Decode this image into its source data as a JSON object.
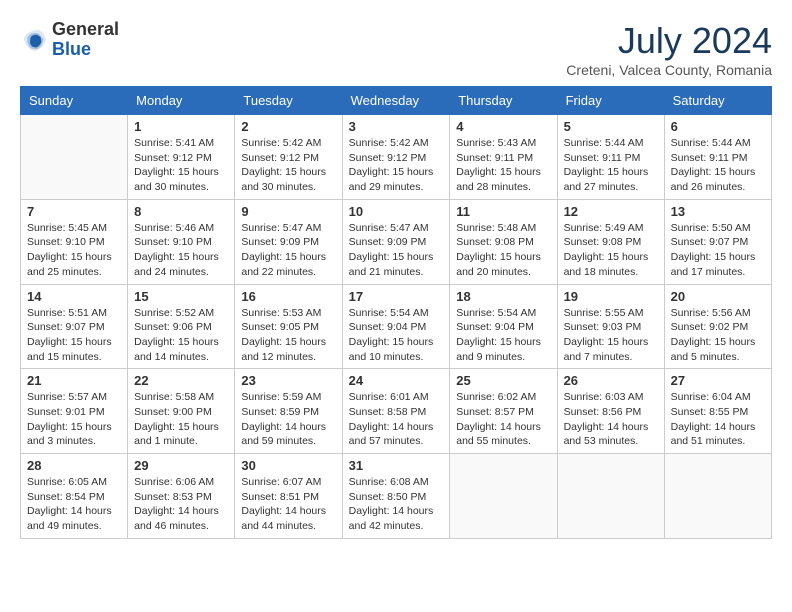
{
  "logo": {
    "general": "General",
    "blue": "Blue"
  },
  "title": "July 2024",
  "subtitle": "Creteni, Valcea County, Romania",
  "days_of_week": [
    "Sunday",
    "Monday",
    "Tuesday",
    "Wednesday",
    "Thursday",
    "Friday",
    "Saturday"
  ],
  "weeks": [
    [
      {
        "num": "",
        "info": ""
      },
      {
        "num": "1",
        "info": "Sunrise: 5:41 AM\nSunset: 9:12 PM\nDaylight: 15 hours\nand 30 minutes."
      },
      {
        "num": "2",
        "info": "Sunrise: 5:42 AM\nSunset: 9:12 PM\nDaylight: 15 hours\nand 30 minutes."
      },
      {
        "num": "3",
        "info": "Sunrise: 5:42 AM\nSunset: 9:12 PM\nDaylight: 15 hours\nand 29 minutes."
      },
      {
        "num": "4",
        "info": "Sunrise: 5:43 AM\nSunset: 9:11 PM\nDaylight: 15 hours\nand 28 minutes."
      },
      {
        "num": "5",
        "info": "Sunrise: 5:44 AM\nSunset: 9:11 PM\nDaylight: 15 hours\nand 27 minutes."
      },
      {
        "num": "6",
        "info": "Sunrise: 5:44 AM\nSunset: 9:11 PM\nDaylight: 15 hours\nand 26 minutes."
      }
    ],
    [
      {
        "num": "7",
        "info": "Sunrise: 5:45 AM\nSunset: 9:10 PM\nDaylight: 15 hours\nand 25 minutes."
      },
      {
        "num": "8",
        "info": "Sunrise: 5:46 AM\nSunset: 9:10 PM\nDaylight: 15 hours\nand 24 minutes."
      },
      {
        "num": "9",
        "info": "Sunrise: 5:47 AM\nSunset: 9:09 PM\nDaylight: 15 hours\nand 22 minutes."
      },
      {
        "num": "10",
        "info": "Sunrise: 5:47 AM\nSunset: 9:09 PM\nDaylight: 15 hours\nand 21 minutes."
      },
      {
        "num": "11",
        "info": "Sunrise: 5:48 AM\nSunset: 9:08 PM\nDaylight: 15 hours\nand 20 minutes."
      },
      {
        "num": "12",
        "info": "Sunrise: 5:49 AM\nSunset: 9:08 PM\nDaylight: 15 hours\nand 18 minutes."
      },
      {
        "num": "13",
        "info": "Sunrise: 5:50 AM\nSunset: 9:07 PM\nDaylight: 15 hours\nand 17 minutes."
      }
    ],
    [
      {
        "num": "14",
        "info": "Sunrise: 5:51 AM\nSunset: 9:07 PM\nDaylight: 15 hours\nand 15 minutes."
      },
      {
        "num": "15",
        "info": "Sunrise: 5:52 AM\nSunset: 9:06 PM\nDaylight: 15 hours\nand 14 minutes."
      },
      {
        "num": "16",
        "info": "Sunrise: 5:53 AM\nSunset: 9:05 PM\nDaylight: 15 hours\nand 12 minutes."
      },
      {
        "num": "17",
        "info": "Sunrise: 5:54 AM\nSunset: 9:04 PM\nDaylight: 15 hours\nand 10 minutes."
      },
      {
        "num": "18",
        "info": "Sunrise: 5:54 AM\nSunset: 9:04 PM\nDaylight: 15 hours\nand 9 minutes."
      },
      {
        "num": "19",
        "info": "Sunrise: 5:55 AM\nSunset: 9:03 PM\nDaylight: 15 hours\nand 7 minutes."
      },
      {
        "num": "20",
        "info": "Sunrise: 5:56 AM\nSunset: 9:02 PM\nDaylight: 15 hours\nand 5 minutes."
      }
    ],
    [
      {
        "num": "21",
        "info": "Sunrise: 5:57 AM\nSunset: 9:01 PM\nDaylight: 15 hours\nand 3 minutes."
      },
      {
        "num": "22",
        "info": "Sunrise: 5:58 AM\nSunset: 9:00 PM\nDaylight: 15 hours\nand 1 minute."
      },
      {
        "num": "23",
        "info": "Sunrise: 5:59 AM\nSunset: 8:59 PM\nDaylight: 14 hours\nand 59 minutes."
      },
      {
        "num": "24",
        "info": "Sunrise: 6:01 AM\nSunset: 8:58 PM\nDaylight: 14 hours\nand 57 minutes."
      },
      {
        "num": "25",
        "info": "Sunrise: 6:02 AM\nSunset: 8:57 PM\nDaylight: 14 hours\nand 55 minutes."
      },
      {
        "num": "26",
        "info": "Sunrise: 6:03 AM\nSunset: 8:56 PM\nDaylight: 14 hours\nand 53 minutes."
      },
      {
        "num": "27",
        "info": "Sunrise: 6:04 AM\nSunset: 8:55 PM\nDaylight: 14 hours\nand 51 minutes."
      }
    ],
    [
      {
        "num": "28",
        "info": "Sunrise: 6:05 AM\nSunset: 8:54 PM\nDaylight: 14 hours\nand 49 minutes."
      },
      {
        "num": "29",
        "info": "Sunrise: 6:06 AM\nSunset: 8:53 PM\nDaylight: 14 hours\nand 46 minutes."
      },
      {
        "num": "30",
        "info": "Sunrise: 6:07 AM\nSunset: 8:51 PM\nDaylight: 14 hours\nand 44 minutes."
      },
      {
        "num": "31",
        "info": "Sunrise: 6:08 AM\nSunset: 8:50 PM\nDaylight: 14 hours\nand 42 minutes."
      },
      {
        "num": "",
        "info": ""
      },
      {
        "num": "",
        "info": ""
      },
      {
        "num": "",
        "info": ""
      }
    ]
  ]
}
